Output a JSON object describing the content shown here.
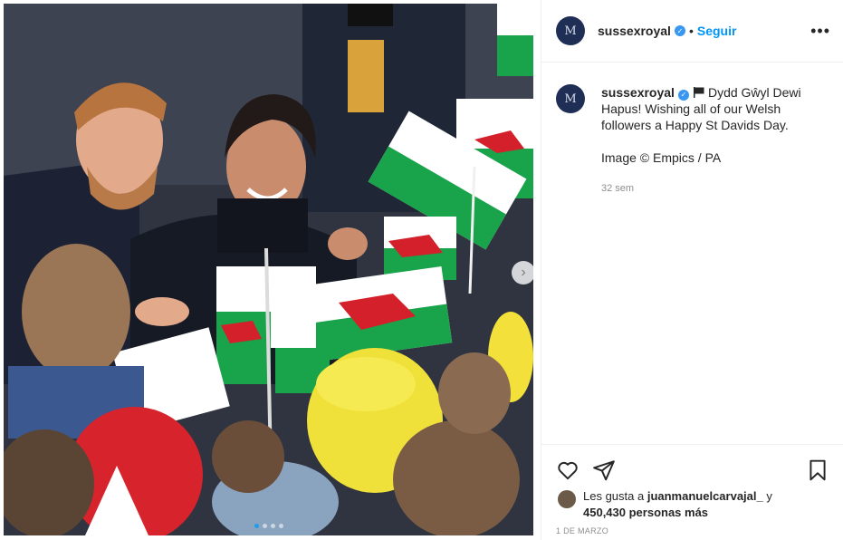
{
  "post": {
    "username": "sussexroyal",
    "follow_label": "Seguir",
    "separator": "•",
    "more_label": "•••",
    "avatar_monogram": "M",
    "caption_line": "Dydd Gŵyl Dewi Hapus! Wishing all of our Welsh followers a Happy St Davids Day.",
    "caption_credit": "Image © Empics / PA",
    "timestamp": "32 sem",
    "likes_prefix": "Les gusta a ",
    "likes_user": "juanmanuelcarvajal_",
    "likes_mid": " y",
    "likes_count": "450,430 personas más",
    "date": "1 DE MARZO",
    "carousel_next": "›"
  },
  "icons": {
    "verified": "verified-badge-icon",
    "flag": "black-flag-emoji",
    "like": "heart-icon",
    "share": "paper-plane-icon",
    "save": "bookmark-icon"
  },
  "colors": {
    "follow_blue": "#0095f6",
    "verified_blue": "#3897f0",
    "muted": "#8e8e8e",
    "text": "#262626"
  }
}
